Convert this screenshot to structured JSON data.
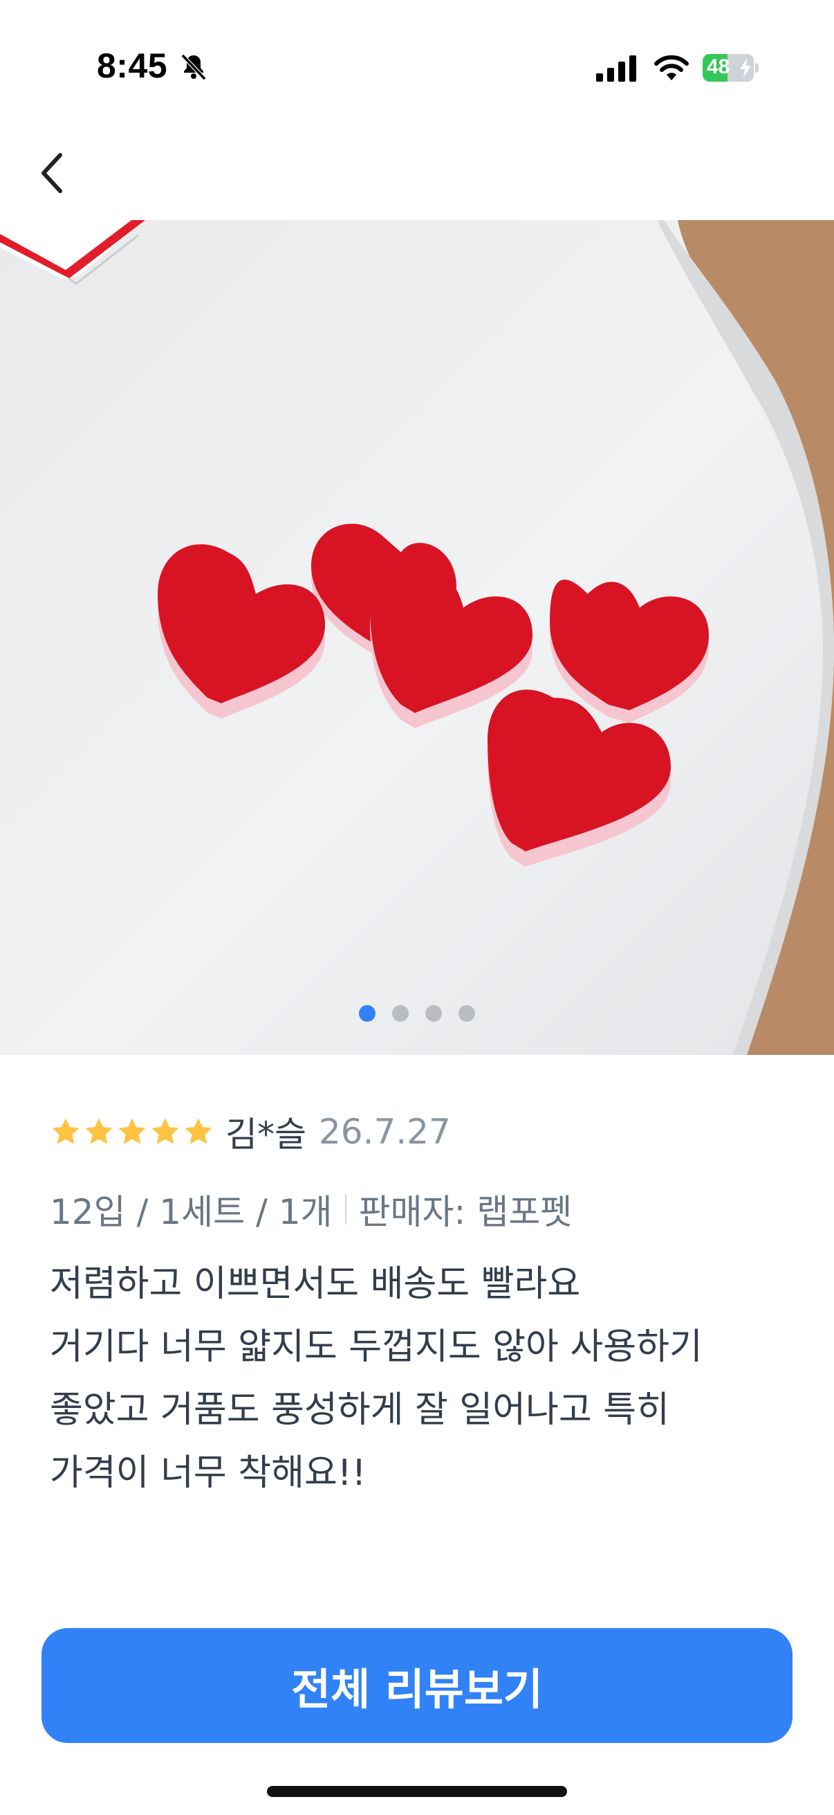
{
  "status_bar": {
    "time": "8:45",
    "battery_level": "48",
    "icons": [
      "bell-slash-icon",
      "cellular-signal-icon",
      "wifi-icon",
      "battery-charging-icon"
    ]
  },
  "nav": {
    "back_icon": "chevron-left-icon"
  },
  "gallery": {
    "image_description": "product photo",
    "page_count": 4,
    "current_page": 1,
    "active_color": "#3182f6",
    "inactive_color": "#b9bcc1"
  },
  "review": {
    "rating": 5,
    "star_color": "#ffc342",
    "reviewer": "김*슬",
    "date": "26.7.27",
    "option": "12입 / 1세트 / 1개",
    "seller": "판매자: 랩포펫",
    "body_lines": [
      "저렴하고 이쁘면서도 배송도 빨라요",
      "거기다 너무 얇지도 두껍지도 않아 사용하기",
      "좋았고 거품도 풍성하게 잘 일어나고 특히",
      "가격이 너무 착해요!!"
    ]
  },
  "footer": {
    "button_label": "전체 리뷰보기",
    "button_color": "#3182f6"
  }
}
